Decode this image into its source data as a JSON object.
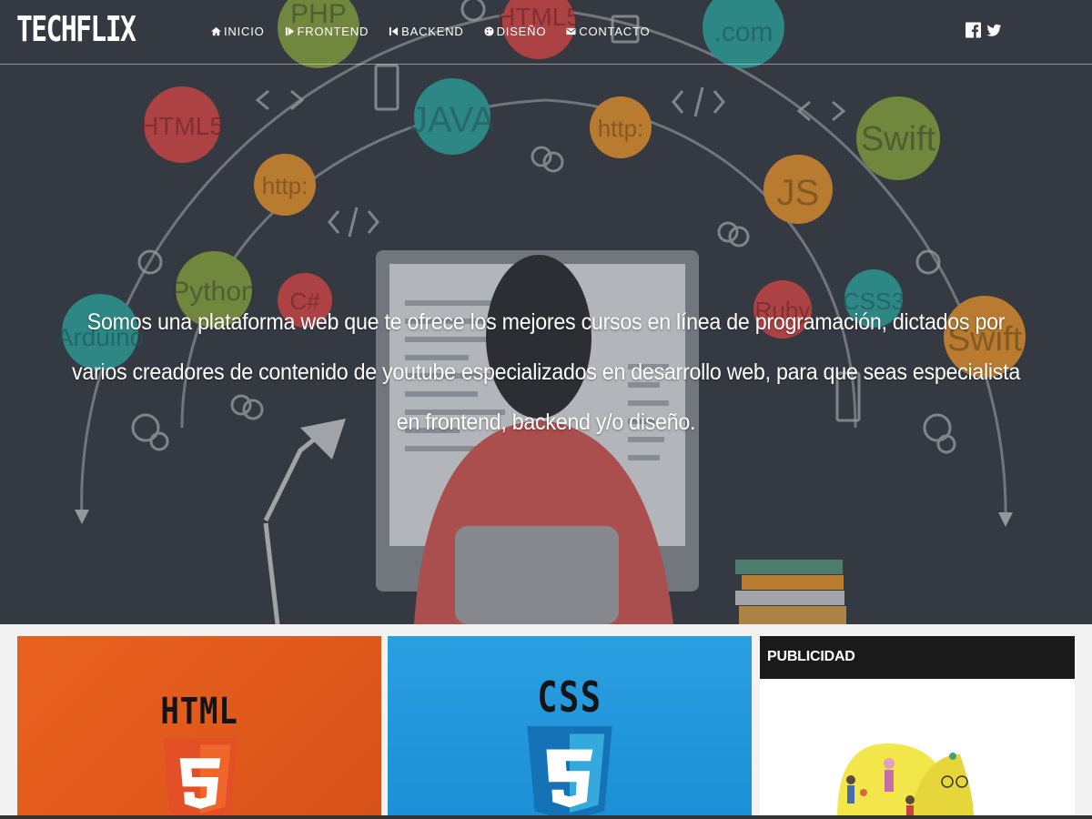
{
  "brand": {
    "logo": "TECHFLIX"
  },
  "nav": {
    "items": [
      {
        "label": "INICIO",
        "icon": "home-icon"
      },
      {
        "label": "FRONTEND",
        "icon": "play-icon"
      },
      {
        "label": "BACKEND",
        "icon": "back-icon"
      },
      {
        "label": "DISEÑO",
        "icon": "palette-icon"
      },
      {
        "label": "CONTACTO",
        "icon": "envelope-icon"
      }
    ],
    "social": [
      {
        "icon": "facebook-icon"
      },
      {
        "icon": "twitter-icon"
      }
    ]
  },
  "hero": {
    "text": "Somos una plataforma web que te ofrece los mejores cursos en línea de programación, dictados por varios creadores de contenido de youtube especializados en desarrollo web, para que seas especialista en frontend, backend y/o diseño.",
    "bubbles": [
      "PHP",
      "HTML5",
      ".com",
      "HTML5",
      "JAVA",
      "http:",
      "Swift",
      "http:",
      "JS",
      "Python",
      "C#",
      "Ruby",
      "CSS3",
      "Swift",
      "Arduino"
    ]
  },
  "cards": [
    {
      "title": "HTML",
      "color": "#e8621f"
    },
    {
      "title": "CSS",
      "color": "#2a9fe0"
    }
  ],
  "sidebar": {
    "title": "PUBLICIDAD"
  }
}
